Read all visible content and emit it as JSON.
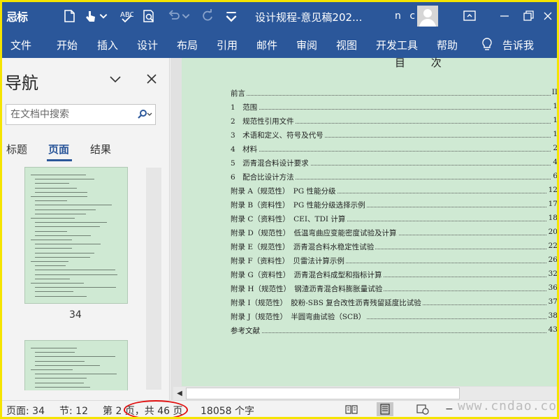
{
  "titlebar": {
    "logo": "忌标",
    "doc_title": "设计规程-意见稿202...",
    "user": "n c",
    "icons": [
      "save-icon",
      "touch-mode-icon",
      "spell-check-icon",
      "print-preview-icon",
      "undo-icon",
      "redo-icon",
      "customize-icon",
      "ribbon-display-icon"
    ]
  },
  "ribbon": {
    "tabs": [
      "文件",
      "开始",
      "插入",
      "设计",
      "布局",
      "引用",
      "邮件",
      "审阅",
      "视图",
      "开发工具",
      "帮助"
    ],
    "tell_me": "告诉我"
  },
  "nav": {
    "title": "导航",
    "search_placeholder": "在文档中搜索",
    "tabs": [
      "标题",
      "页面",
      "结果"
    ],
    "active_tab": "页面",
    "thumbnail_label": "34"
  },
  "document": {
    "heading": "目 次",
    "toc": [
      {
        "title": "前言",
        "page": "II"
      },
      {
        "title": "1　范围",
        "page": "1"
      },
      {
        "title": "2　规范性引用文件",
        "page": "1"
      },
      {
        "title": "3　术语和定义、符号及代号",
        "page": "1"
      },
      {
        "title": "4　材料",
        "page": "2"
      },
      {
        "title": "5　沥青混合料设计要求",
        "page": "4"
      },
      {
        "title": "6　配合比设计方法",
        "page": "6"
      },
      {
        "title": "附录 A（规范性）　PG 性能分级",
        "page": "12"
      },
      {
        "title": "附录 B（资料性）　PG 性能分级选择示例",
        "page": "17"
      },
      {
        "title": "附录 C（资料性）　CEI、TDI 计算",
        "page": "18"
      },
      {
        "title": "附录 D（规范性）　低温弯曲应变能密度试验及计算",
        "page": "20"
      },
      {
        "title": "附录 E（规范性）　沥青混合料水稳定性试验",
        "page": "22"
      },
      {
        "title": "附录 F（资料性）　贝雷法计算示例",
        "page": "26"
      },
      {
        "title": "附录 G（资料性）　沥青混合料成型和指标计算",
        "page": "32"
      },
      {
        "title": "附录 H（规范性）　钢渣沥青混合料膨胀量试验",
        "page": "36"
      },
      {
        "title": "附录 I（规范性）　胶粉-SBS 复合改性沥青残留延度比试验",
        "page": "37"
      },
      {
        "title": "附录 J（规范性）　半圆弯曲试验（SCB）",
        "page": "38"
      },
      {
        "title": "参考文献",
        "page": "43"
      }
    ]
  },
  "status": {
    "page": "页面: 34",
    "section": "节: 12",
    "page_of": "第 2 页，共 46 页",
    "words": "18058 个字",
    "zoom_minus": "−"
  },
  "watermark": "www.cndao.com",
  "colors": {
    "ribbon": "#2b579a",
    "page_bg": "#cfe9d3",
    "highlight": "#e01010",
    "border": "#f5e400"
  }
}
